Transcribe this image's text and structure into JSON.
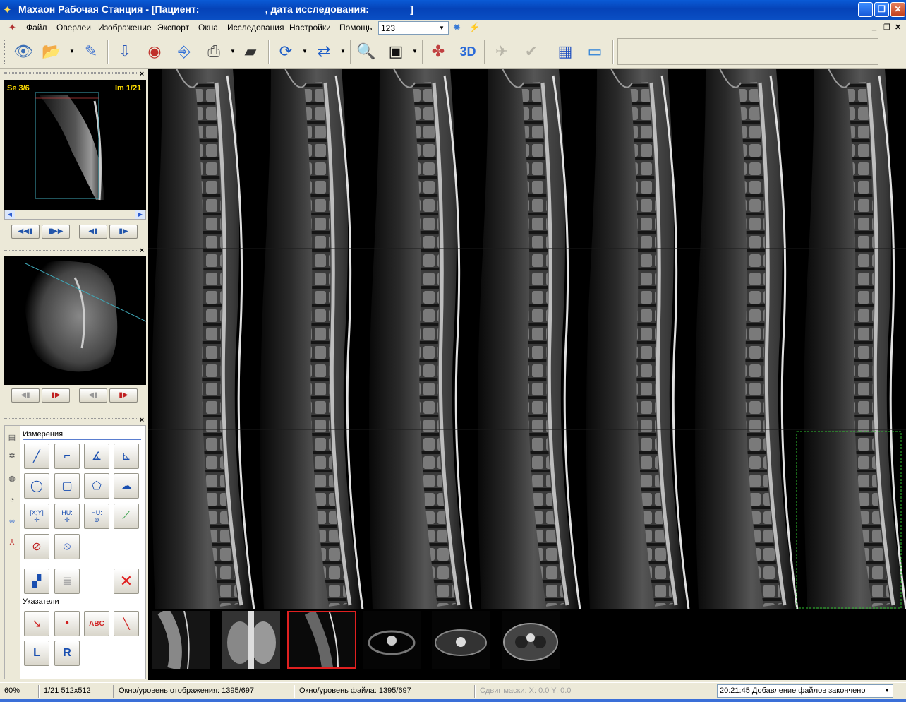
{
  "window": {
    "title": "Махаон Рабочая Станция - [Пациент:                        , дата исследования:               ]"
  },
  "menu": {
    "items": [
      "Файл",
      "Оверлеи",
      "Изображение",
      "Экспорт",
      "Окна",
      "Исследования",
      "Настройки",
      "Помощь"
    ],
    "combo_value": "123"
  },
  "toolbar": {
    "icons": [
      "eye-icon",
      "open-folder-icon",
      "edit-image-icon",
      "import-icon",
      "cd-icon",
      "usb-export-icon",
      "print-icon",
      "scanner-icon",
      "rotate-icon",
      "flip-icon",
      "magnifier-icon",
      "film-icon",
      "color-map-icon",
      "3d-icon",
      "hide-icon",
      "check-icon",
      "monitor-icon",
      "window-icon"
    ],
    "label_3d": "3D"
  },
  "preview1": {
    "series_label": "Se 3/6",
    "image_label": "Im 1/21"
  },
  "tools": {
    "measurements_label": "Измерения",
    "pointers_label": "Указатели",
    "hu_label": "HU:",
    "xy_label": "[X;Y]",
    "abc_label": "ABC",
    "l_label": "L",
    "r_label": "R"
  },
  "status": {
    "zoom": "60%",
    "image_info": "1/21 512x512",
    "display_window": "Окно/уровень отображения: 1395/697",
    "file_window": "Окно/уровень файла: 1395/697",
    "mask_shift": "Сдвиг маски: X: 0.0 Y: 0.0",
    "log": "20:21:45 Добавление файлов закончено"
  }
}
